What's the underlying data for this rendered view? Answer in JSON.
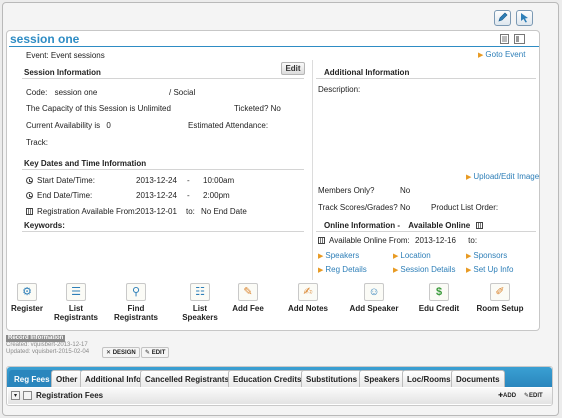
{
  "page": {
    "title": "session one"
  },
  "icons": {
    "edit": "pencil-icon",
    "select": "cursor-icon",
    "print": "page-icon",
    "layout": "layout-icon"
  },
  "event": {
    "label": "Event:",
    "value": "Event sessions",
    "goto_event": "Goto Event"
  },
  "session_info": {
    "heading": "Session Information",
    "edit_label": "Edit",
    "code_label": "Code:",
    "code_value": "session one",
    "category": "/ Social",
    "capacity_text": "The Capacity of this Session is Unlimited",
    "ticketed_label": "Ticketed?",
    "ticketed_value": "No",
    "availability_text": "Current Availability is",
    "availability_value": "0",
    "estimated_label": "Estimated Attendance:",
    "track_label": "Track:"
  },
  "additional_info": {
    "heading": "Additional Information",
    "description_label": "Description:",
    "upload_link": "Upload/Edit Image",
    "members_only_label": "Members Only?",
    "members_only_value": "No",
    "track_scores_label": "Track Scores/Grades?",
    "track_scores_value": "No",
    "product_list_label": "Product List Order:"
  },
  "key_dates": {
    "heading": "Key Dates and Time Information",
    "start_label": "Start Date/Time:",
    "start_date": "2013-12-24",
    "start_sep": "-",
    "start_time": "10:00am",
    "end_label": "End Date/Time:",
    "end_date": "2013-12-24",
    "end_sep": "-",
    "end_time": "2:00pm",
    "reg_label": "Registration Available From:",
    "reg_date": "2013-12-01",
    "reg_to": "to:",
    "reg_end": "No End Date",
    "keywords_label": "Keywords:"
  },
  "online_info": {
    "heading": "Online Information -",
    "available_label": "Available Online",
    "from_label": "Available Online From:",
    "from_date": "2013-12-16",
    "to_label": "to:",
    "links": [
      "Speakers",
      "Location",
      "Sponsors",
      "Reg Details",
      "Session Details",
      "Set Up Info"
    ]
  },
  "toolbar": {
    "items": [
      {
        "line1": "Register",
        "line2": "",
        "icon": "register-icon"
      },
      {
        "line1": "List",
        "line2": "Registrants",
        "icon": "list-icon"
      },
      {
        "line1": "Find",
        "line2": "Registrants",
        "icon": "find-icon"
      },
      {
        "line1": "List",
        "line2": "Speakers",
        "icon": "speaker-list-icon"
      },
      {
        "line1": "Add Fee",
        "line2": "",
        "icon": "add-fee-icon"
      },
      {
        "line1": "Add Notes",
        "line2": "",
        "icon": "add-notes-icon"
      },
      {
        "line1": "Add Speaker",
        "line2": "",
        "icon": "add-speaker-icon"
      },
      {
        "line1": "Edu Credit",
        "line2": "",
        "icon": "edu-credit-icon"
      },
      {
        "line1": "Room Setup",
        "line2": "",
        "icon": "room-setup-icon"
      }
    ]
  },
  "record": {
    "heading": "Record Information",
    "created": "Created: vquisbert-2013-12-17",
    "updated": "Updated: vquisbert-2015-02-04",
    "design_label": "DESIGN",
    "edit_label": "EDIT"
  },
  "tabs": {
    "items": [
      "Reg Fees",
      "Other",
      "Additional Info",
      "Cancelled Registrants",
      "Education Credits",
      "Substitutions",
      "Speakers",
      "Loc/Rooms",
      "Documents"
    ],
    "active_index": 0,
    "section_label": "Registration Fees",
    "add_label": "ADD",
    "edit_label": "EDIT"
  },
  "colors": {
    "accent": "#2e8cc4",
    "link": "#2e7fb8",
    "arrow": "#e89a22"
  }
}
